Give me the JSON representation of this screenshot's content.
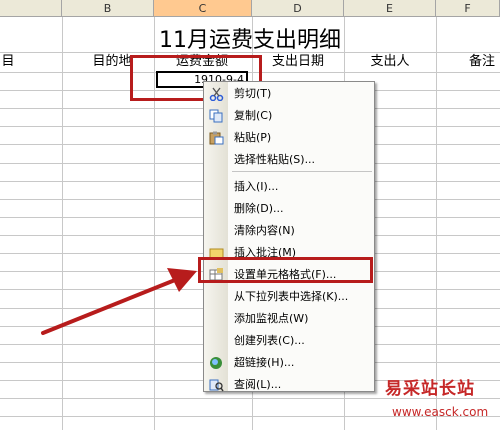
{
  "spreadsheet": {
    "columns": [
      "B",
      "C",
      "D",
      "E",
      "F"
    ],
    "selected_column": "C",
    "title": "11月运费支出明细",
    "headers": [
      "目",
      "目的地",
      "运费金额",
      "支出日期",
      "支出人",
      "备注"
    ],
    "active_cell_value": "1910-9-4"
  },
  "context_menu": {
    "items": [
      {
        "label": "剪切(T)",
        "icon": "scissors-icon"
      },
      {
        "label": "复制(C)",
        "icon": "copy-icon"
      },
      {
        "label": "粘贴(P)",
        "icon": "paste-icon"
      },
      {
        "label": "选择性粘贴(S)...",
        "icon": ""
      },
      {
        "label": "插入(I)...",
        "icon": ""
      },
      {
        "label": "删除(D)...",
        "icon": ""
      },
      {
        "label": "清除内容(N)",
        "icon": ""
      },
      {
        "label": "插入批注(M)",
        "icon": "comment-icon"
      },
      {
        "label": "设置单元格格式(F)...",
        "icon": "format-cells-icon"
      },
      {
        "label": "从下拉列表中选择(K)...",
        "icon": ""
      },
      {
        "label": "添加监视点(W)",
        "icon": ""
      },
      {
        "label": "创建列表(C)...",
        "icon": ""
      },
      {
        "label": "超链接(H)...",
        "icon": "hyperlink-icon"
      },
      {
        "label": "查阅(L)...",
        "icon": "research-icon"
      }
    ],
    "highlighted_item": "设置单元格格式(F)..."
  },
  "watermark": {
    "title": "易采站长站",
    "url": "www.easck.com"
  },
  "colors": {
    "annotation_red": "#b71c1c",
    "selected_header": "#ffc990"
  }
}
